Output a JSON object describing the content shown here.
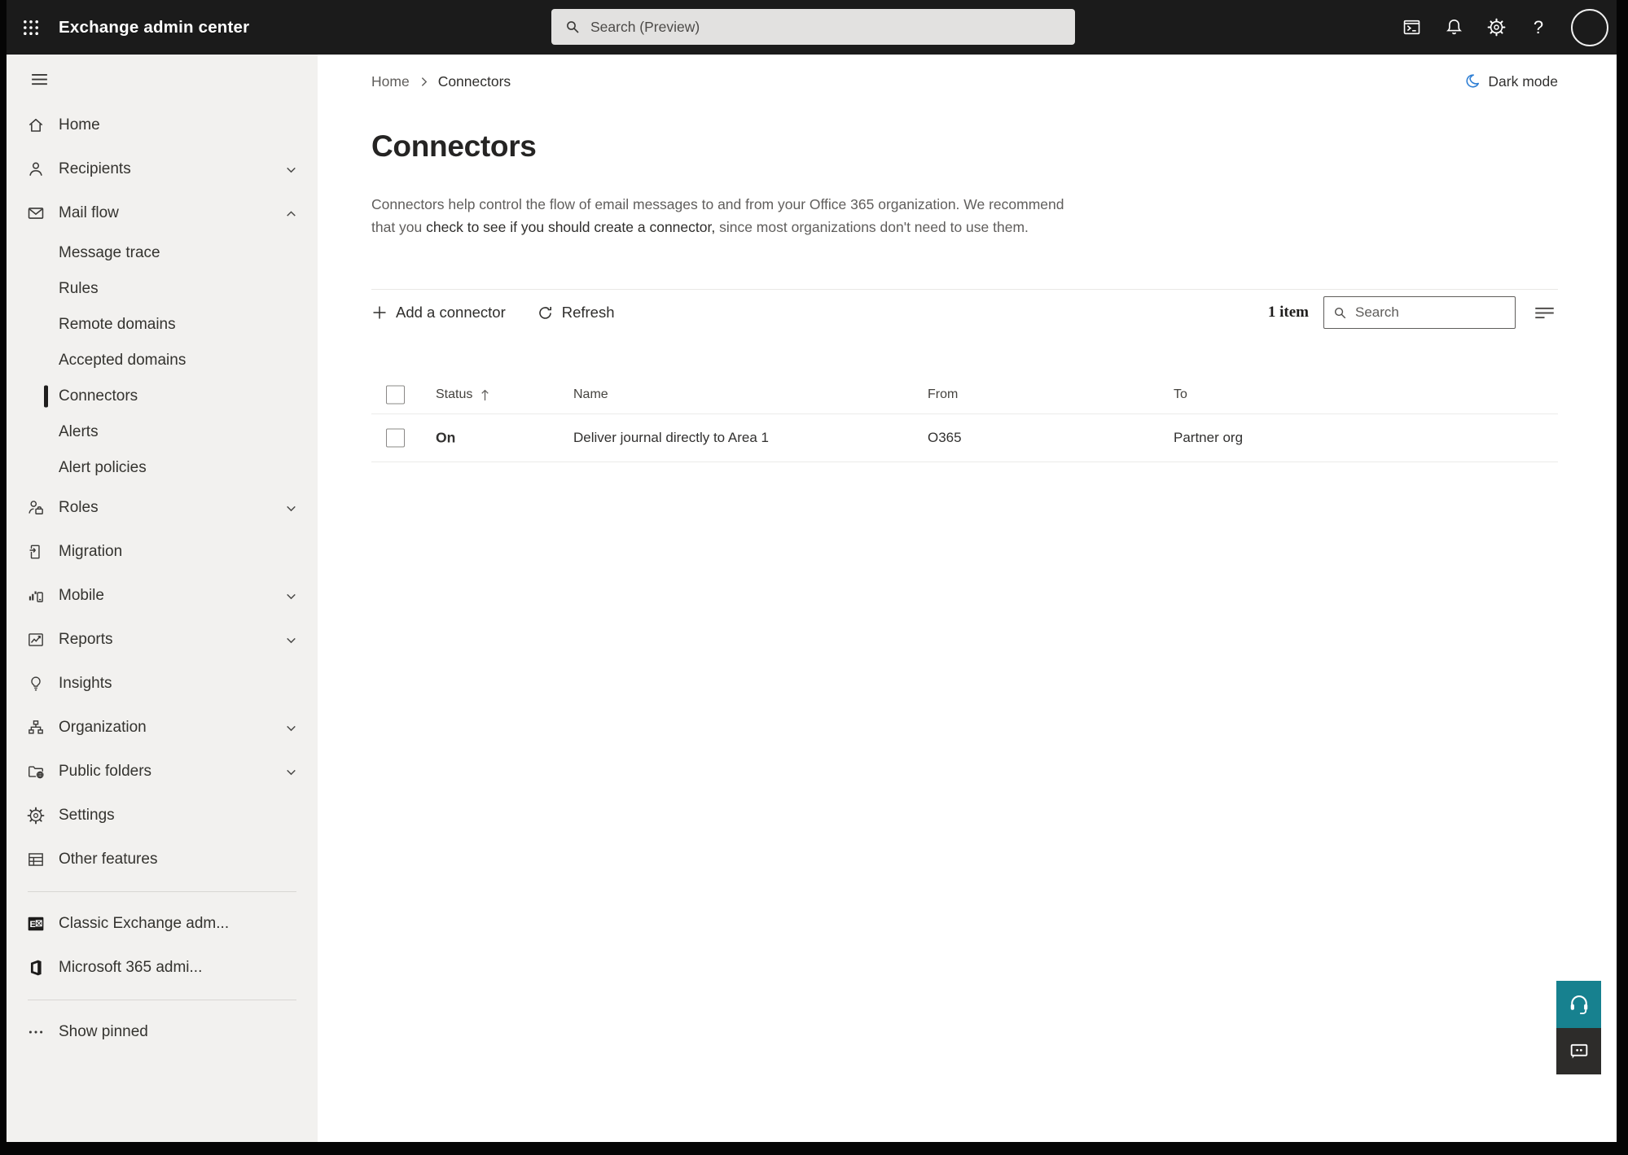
{
  "topbar": {
    "app_title": "Exchange admin center",
    "search_placeholder": "Search (Preview)",
    "icons": [
      "app-launcher",
      "cloud-shell",
      "notifications",
      "settings",
      "help",
      "account"
    ]
  },
  "sidebar": {
    "items": [
      {
        "label": "Home"
      },
      {
        "label": "Recipients"
      },
      {
        "label": "Mail flow"
      },
      {
        "label": "Message trace"
      },
      {
        "label": "Rules"
      },
      {
        "label": "Remote domains"
      },
      {
        "label": "Accepted domains"
      },
      {
        "label": "Connectors"
      },
      {
        "label": "Alerts"
      },
      {
        "label": "Alert policies"
      },
      {
        "label": "Roles"
      },
      {
        "label": "Migration"
      },
      {
        "label": "Mobile"
      },
      {
        "label": "Reports"
      },
      {
        "label": "Insights"
      },
      {
        "label": "Organization"
      },
      {
        "label": "Public folders"
      },
      {
        "label": "Settings"
      },
      {
        "label": "Other features"
      },
      {
        "label": "Classic Exchange adm..."
      },
      {
        "label": "Microsoft 365 admi..."
      },
      {
        "label": "Show pinned"
      }
    ]
  },
  "breadcrumb": {
    "home": "Home",
    "current": "Connectors"
  },
  "dark_mode_label": "Dark mode",
  "page": {
    "title": "Connectors",
    "description_pre": "Connectors help control the flow of email messages to and from your Office 365 organization. We recommend that you ",
    "description_link": "check to see if you should create a connector,",
    "description_post": " since most organizations don't need to use them."
  },
  "toolbar": {
    "add_label": "Add a connector",
    "refresh_label": "Refresh",
    "item_count": "1 item",
    "search_placeholder": "Search"
  },
  "table": {
    "columns": [
      "Status",
      "Name",
      "From",
      "To"
    ],
    "rows": [
      {
        "status": "On",
        "name": "Deliver journal directly to Area 1",
        "from": "O365",
        "to": "Partner org"
      }
    ]
  },
  "colors": {
    "topbar_bg": "#1b1b1b",
    "sidebar_bg": "#f2f1ef",
    "support_teal": "#17818f",
    "feedback_dark": "#2d2c2a",
    "moon_blue": "#2f7fd4"
  }
}
